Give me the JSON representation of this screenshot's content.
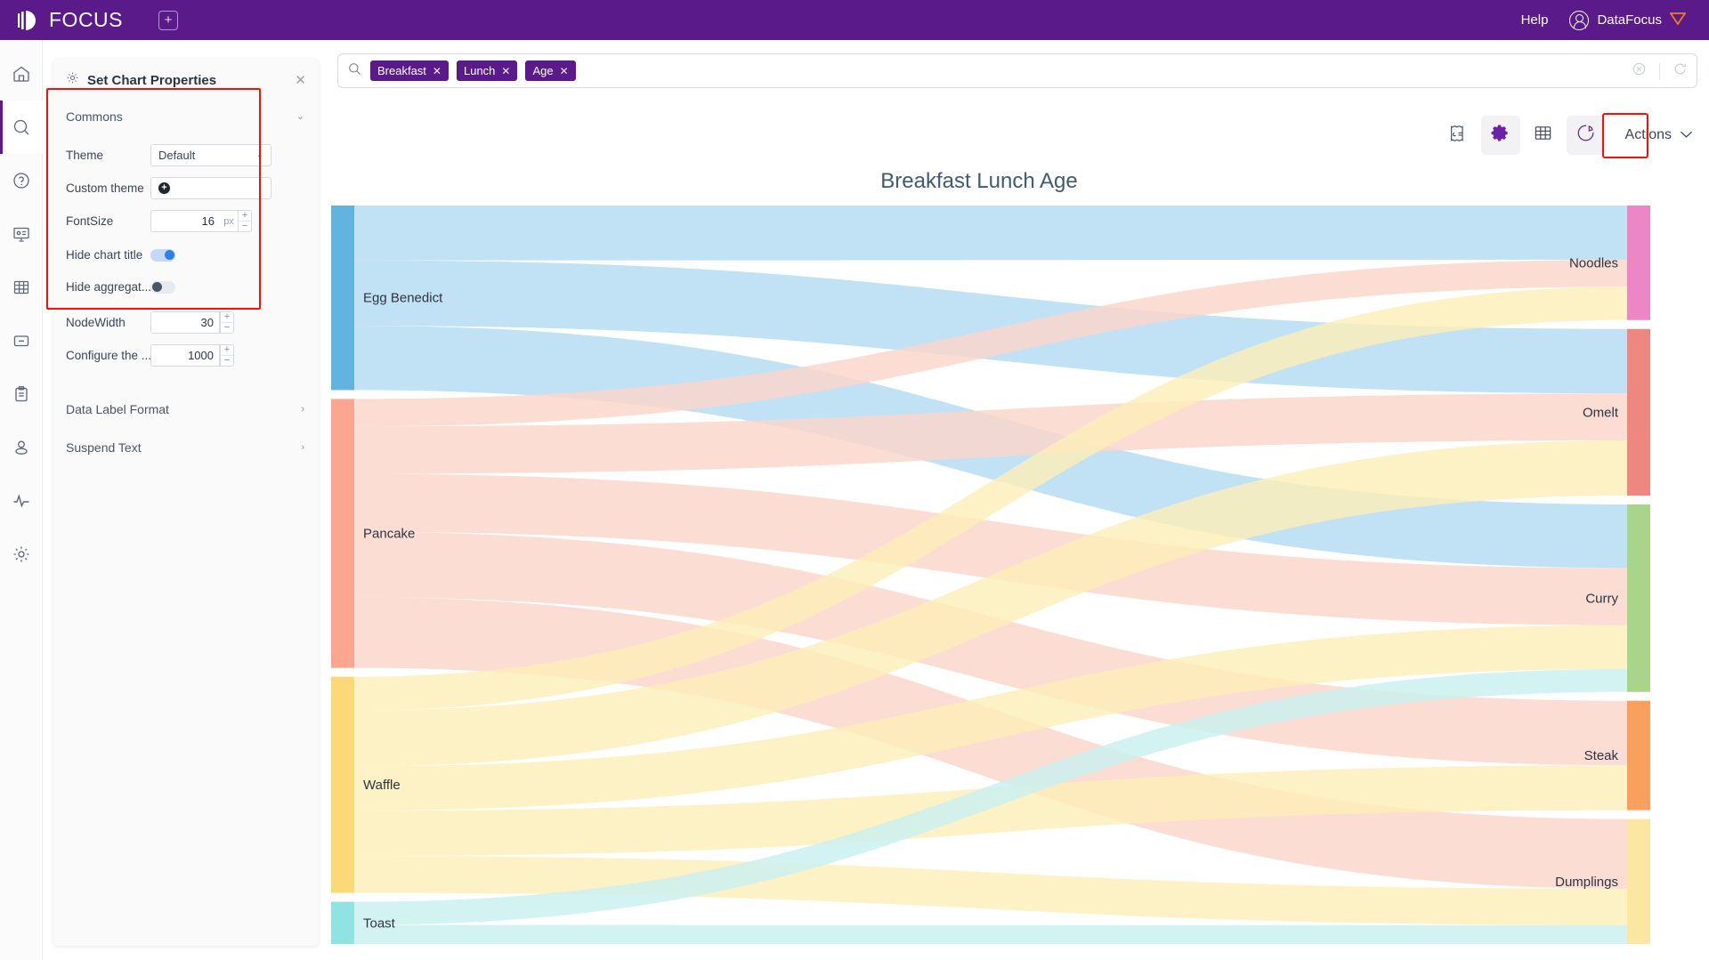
{
  "topbar": {
    "brand": "FOCUS",
    "add_tab_icon": "plus-square-icon",
    "help_label": "Help",
    "user_label": "DataFocus",
    "diamond_icon": "diamond-icon"
  },
  "rail": {
    "items": [
      {
        "name": "home-icon",
        "active": false
      },
      {
        "name": "search-icon",
        "active": true
      },
      {
        "name": "help-circle-icon",
        "active": false
      },
      {
        "name": "presentation-icon",
        "active": false
      },
      {
        "name": "table-icon",
        "active": false
      },
      {
        "name": "folder-icon",
        "active": false
      },
      {
        "name": "clipboard-icon",
        "active": false
      },
      {
        "name": "user-icon",
        "active": false
      },
      {
        "name": "activity-icon",
        "active": false
      },
      {
        "name": "settings-icon",
        "active": false
      }
    ]
  },
  "panel": {
    "title": "Set Chart Properties",
    "gear_icon": "gear-icon",
    "close_icon": "close-icon",
    "sections": {
      "commons": {
        "label": "Commons",
        "chevron": "chevron-down-icon",
        "rows": {
          "theme": {
            "label": "Theme",
            "value": "Default",
            "chevron": "chevron-down-icon"
          },
          "custom_theme": {
            "label": "Custom theme",
            "add_icon": "plus-circle-icon"
          },
          "font_size": {
            "label": "FontSize",
            "value": "16",
            "unit": "px"
          },
          "hide_chart_title": {
            "label": "Hide chart title",
            "state": "on"
          },
          "hide_aggregate": {
            "label": "Hide aggregat...",
            "state": "off"
          },
          "node_width": {
            "label": "NodeWidth",
            "value": "30"
          },
          "configure": {
            "label": "Configure the ...",
            "value": "1000"
          }
        }
      },
      "data_label_format": {
        "label": "Data Label Format",
        "chevron": "chevron-right-icon"
      },
      "suspend_text": {
        "label": "Suspend Text",
        "chevron": "chevron-right-icon"
      }
    }
  },
  "search": {
    "search_icon": "search-icon",
    "chips": [
      "Breakfast",
      "Lunch",
      "Age"
    ],
    "clear_icon": "clear-circle-icon",
    "refresh_icon": "refresh-icon"
  },
  "toolbar": {
    "buttons": [
      {
        "name": "insights-icon",
        "label": ""
      },
      {
        "name": "gear-icon",
        "label": ""
      },
      {
        "name": "table-icon",
        "label": ""
      },
      {
        "name": "chart-icon",
        "label": ""
      }
    ],
    "actions_label": "Actions",
    "actions_chevron": "chevron-down-icon"
  },
  "chart_data": {
    "type": "sankey",
    "title": "Breakfast Lunch Age",
    "xlabel": "",
    "ylabel": "",
    "grid": false,
    "legend": "none",
    "source_nodes": [
      {
        "name": "Egg Benedict",
        "color": "#62b4df",
        "value": 175
      },
      {
        "name": "Pancake",
        "color": "#fca68f",
        "value": 255
      },
      {
        "name": "Waffle",
        "color": "#fcd978",
        "value": 205
      },
      {
        "name": "Toast",
        "color": "#8fe3e0",
        "value": 40
      }
    ],
    "target_nodes": [
      {
        "name": "Noodles",
        "color": "#ec86c4",
        "value": 110
      },
      {
        "name": "Omelt",
        "color": "#ee8780",
        "value": 160
      },
      {
        "name": "Curry",
        "color": "#a8d58a",
        "value": 180
      },
      {
        "name": "Steak",
        "color": "#f9a05e",
        "value": 105
      },
      {
        "name": "Dumplings",
        "color": "#fbe7a2",
        "value": 120
      }
    ],
    "links": [
      {
        "source": "Egg Benedict",
        "target": "Noodles",
        "value": 52,
        "color": "#b3dcf2"
      },
      {
        "source": "Egg Benedict",
        "target": "Omelt",
        "value": 62,
        "color": "#b3dcf2"
      },
      {
        "source": "Egg Benedict",
        "target": "Curry",
        "value": 61,
        "color": "#b3dcf2"
      },
      {
        "source": "Pancake",
        "target": "Noodles",
        "value": 26,
        "color": "#fbd5cb"
      },
      {
        "source": "Pancake",
        "target": "Omelt",
        "value": 45,
        "color": "#fbd5cb"
      },
      {
        "source": "Pancake",
        "target": "Curry",
        "value": 55,
        "color": "#fbd5cb"
      },
      {
        "source": "Pancake",
        "target": "Steak",
        "value": 62,
        "color": "#fbd5cb"
      },
      {
        "source": "Pancake",
        "target": "Dumplings",
        "value": 67,
        "color": "#fbd5cb"
      },
      {
        "source": "Waffle",
        "target": "Noodles",
        "value": 32,
        "color": "#fdeeb9"
      },
      {
        "source": "Waffle",
        "target": "Omelt",
        "value": 53,
        "color": "#fdeeb9"
      },
      {
        "source": "Waffle",
        "target": "Curry",
        "value": 42,
        "color": "#fdeeb9"
      },
      {
        "source": "Waffle",
        "target": "Steak",
        "value": 43,
        "color": "#fdeeb9"
      },
      {
        "source": "Waffle",
        "target": "Dumplings",
        "value": 35,
        "color": "#fdeeb9"
      },
      {
        "source": "Toast",
        "target": "Curry",
        "value": 22,
        "color": "#c9f0ef"
      },
      {
        "source": "Toast",
        "target": "Dumplings",
        "value": 18,
        "color": "#c9f0ef"
      }
    ]
  }
}
